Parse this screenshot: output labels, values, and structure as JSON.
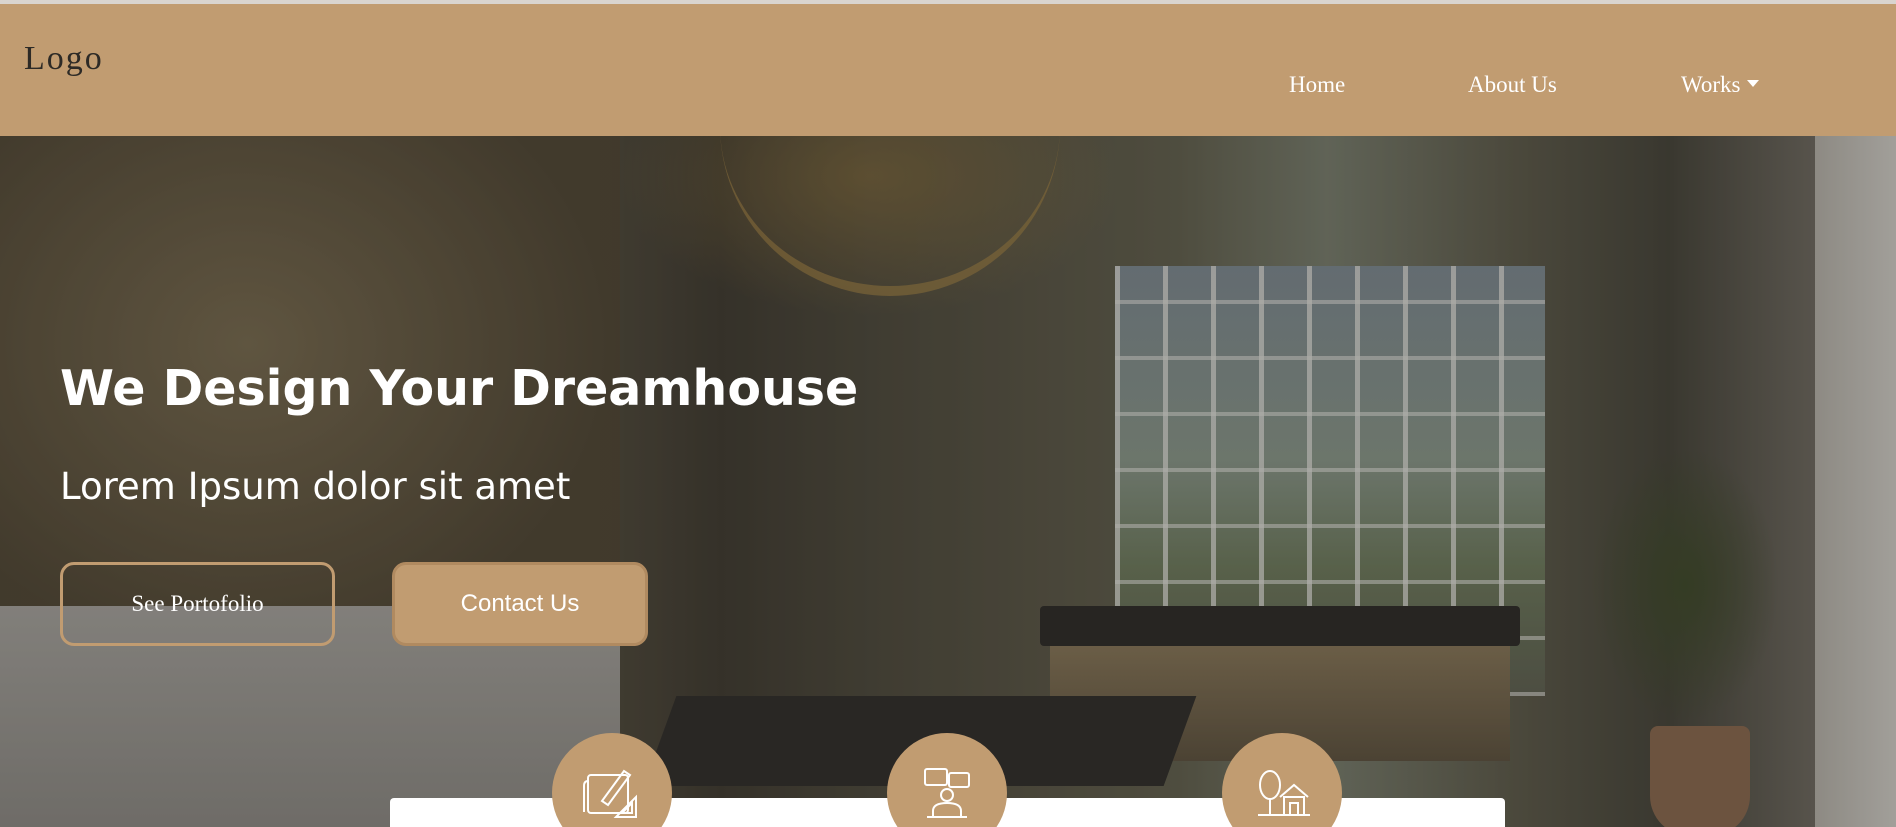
{
  "navbar": {
    "logo": "Logo",
    "links": {
      "home": "Home",
      "about": "About Us",
      "works": "Works"
    }
  },
  "hero": {
    "title": "We Design Your Dreamhouse",
    "subtitle": "Lorem Ipsum dolor sit amet",
    "buttons": {
      "portfolio": "See Portofolio",
      "contact": "Contact Us"
    }
  },
  "features": {
    "icons": [
      "blueprint-drafting-icon",
      "team-meeting-icon",
      "house-tree-icon"
    ]
  },
  "colors": {
    "accent": "#c19c71",
    "text_on_accent": "#ffffff",
    "logo_text": "#2d2a26"
  }
}
